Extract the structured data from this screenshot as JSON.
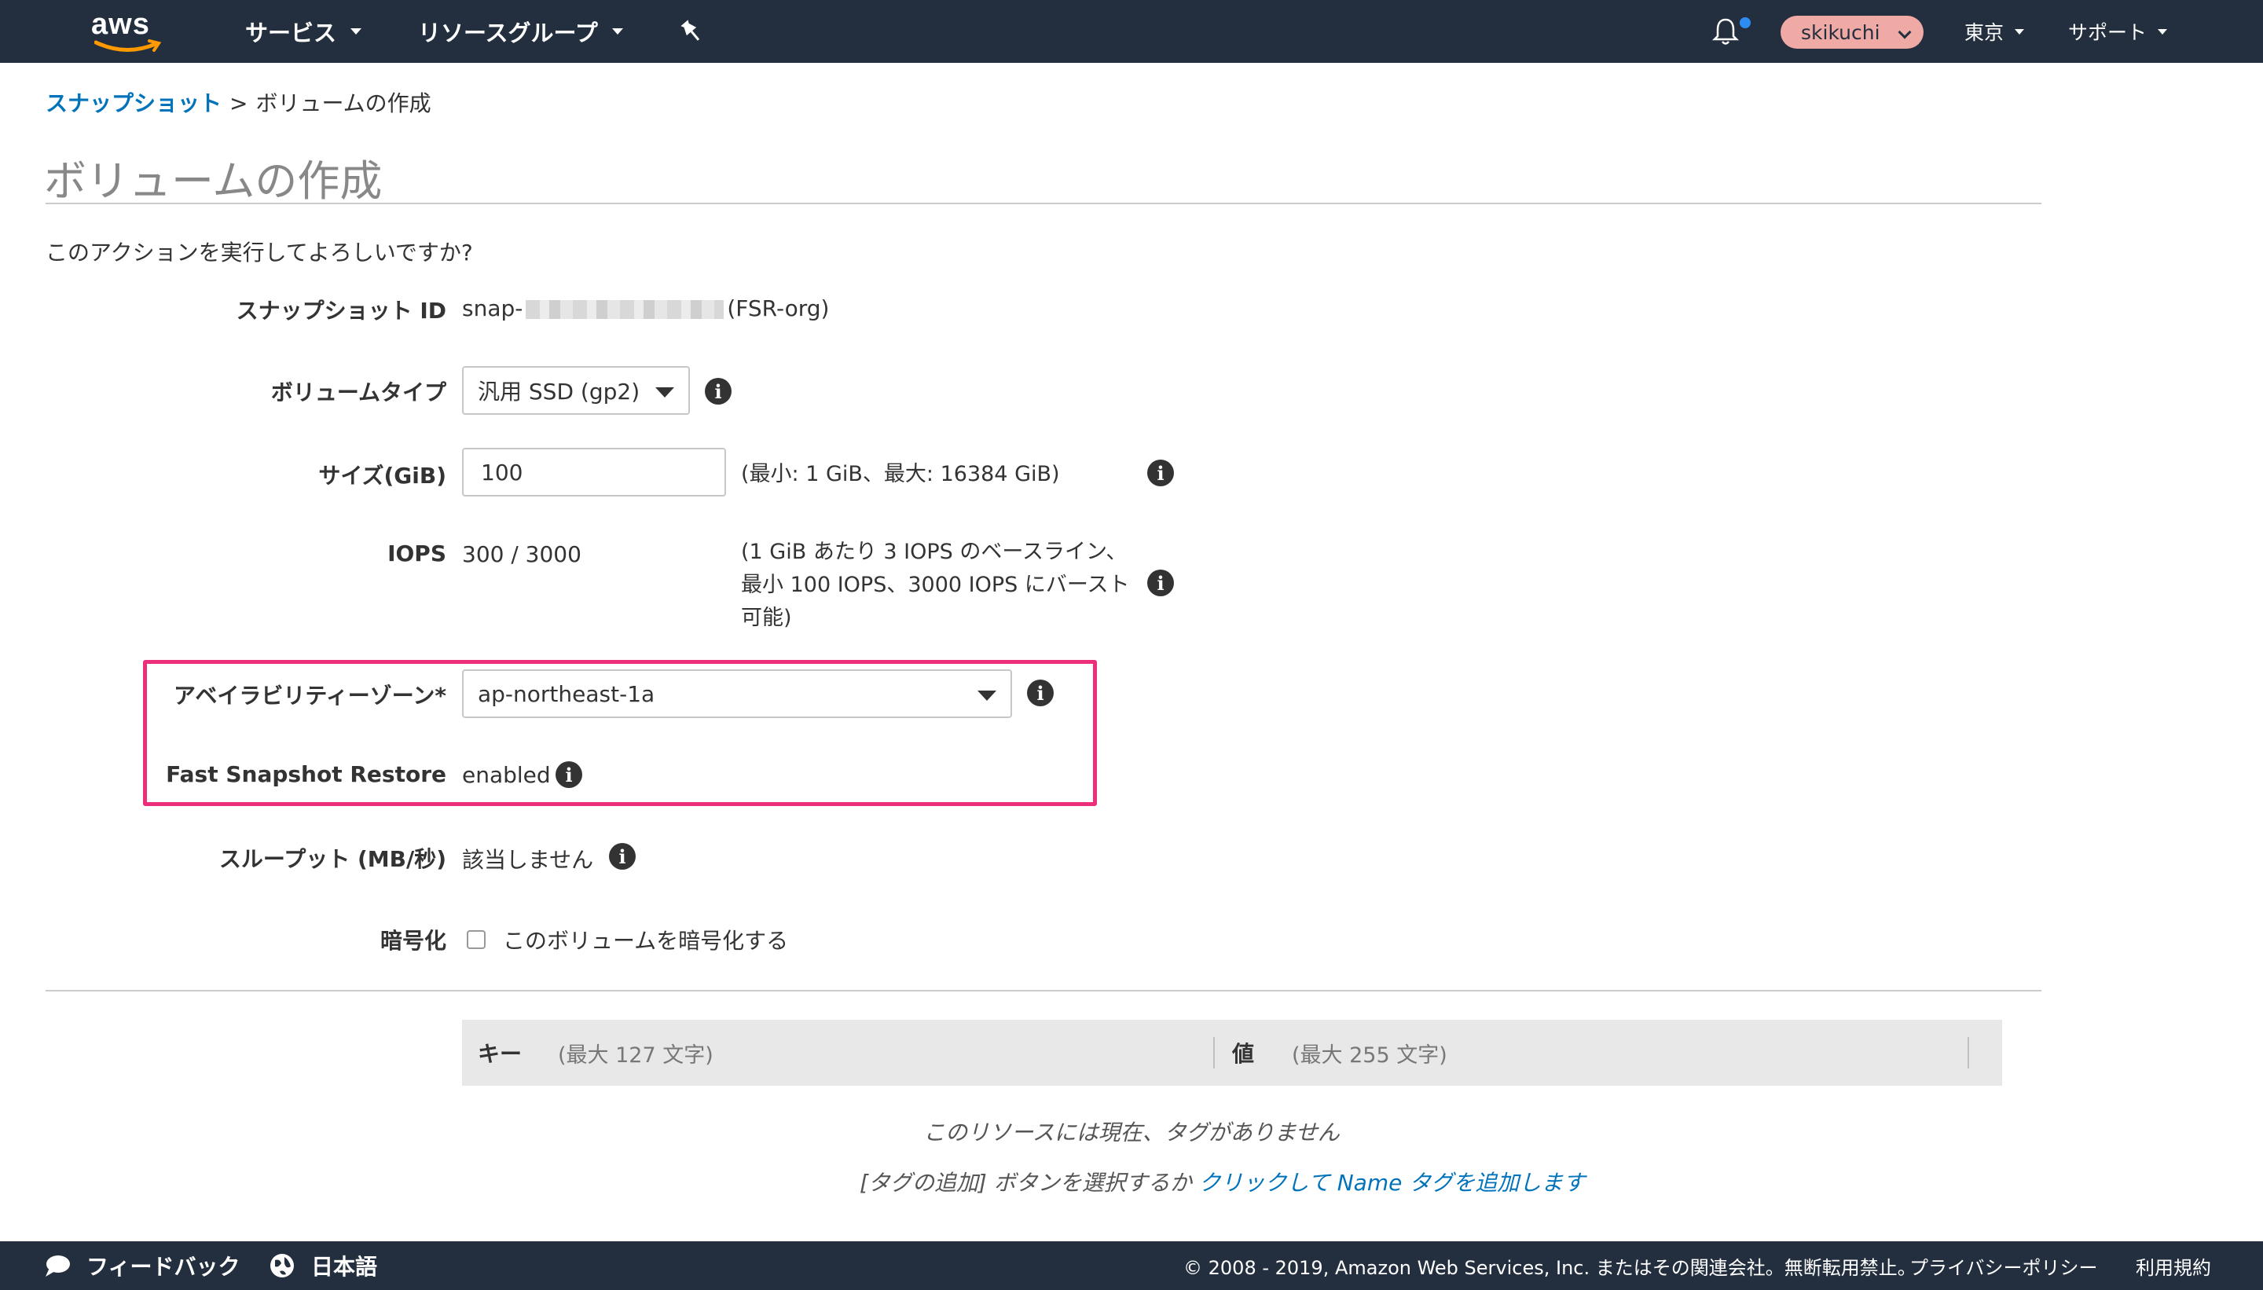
{
  "nav": {
    "logo": "aws",
    "services": "サービス",
    "resource_groups": "リソースグループ",
    "user": "skikuchi",
    "region": "東京",
    "support": "サポート",
    "pin_icon": "pin-icon",
    "bell_icon": "bell-icon"
  },
  "breadcrumb": {
    "parent": "スナップショット",
    "separator": ">",
    "current": "ボリュームの作成"
  },
  "page": {
    "title": "ボリュームの作成",
    "prompt": "このアクションを実行してよろしいですか?"
  },
  "form": {
    "snapshot_id_label": "スナップショット ID",
    "snapshot_id_prefix": "snap-",
    "snapshot_id_suffix": "(FSR-org)",
    "volume_type_label": "ボリュームタイプ",
    "volume_type_value": "汎用 SSD (gp2)",
    "size_label": "サイズ(GiB)",
    "size_value": "100",
    "size_hint": "(最小: 1 GiB、最大: 16384 GiB)",
    "iops_label": "IOPS",
    "iops_value": "300 / 3000",
    "iops_hint_1": "(1 GiB あたり 3 IOPS のベースライン、",
    "iops_hint_2": "最小 100 IOPS、3000 IOPS にバースト",
    "iops_hint_3": "可能)",
    "az_label": "アベイラビリティーゾーン*",
    "az_value": "ap-northeast-1a",
    "fsr_label": "Fast Snapshot Restore",
    "fsr_value": "enabled",
    "throughput_label": "スループット (MB/秒)",
    "throughput_value": "該当しません",
    "encryption_label": "暗号化",
    "encryption_checkbox_label": "このボリュームを暗号化する",
    "encryption_checked": false,
    "info_glyph": "i"
  },
  "tags": {
    "key_header": "キー",
    "key_placeholder": "(最大 127 文字)",
    "value_header": "値",
    "value_placeholder": "(最大 255 文字)",
    "empty_message": "このリソースには現在、タグがありません",
    "add_prefix": "[タグの追加] ボタンを選択するか",
    "add_link": "クリックして Name タグを追加します"
  },
  "footer": {
    "feedback": "フィードバック",
    "language": "日本語",
    "copyright": "© 2008 - 2019, Amazon Web Services, Inc. またはその関連会社。無断転用禁止。",
    "privacy": "プライバシーポリシー",
    "terms": "利用規約"
  },
  "colors": {
    "nav_bg": "#232f3e",
    "link": "#0073bb",
    "highlight": "#ec2f7a",
    "user_pill": "#f0aaa5",
    "notification_dot": "#2e8cf0"
  }
}
